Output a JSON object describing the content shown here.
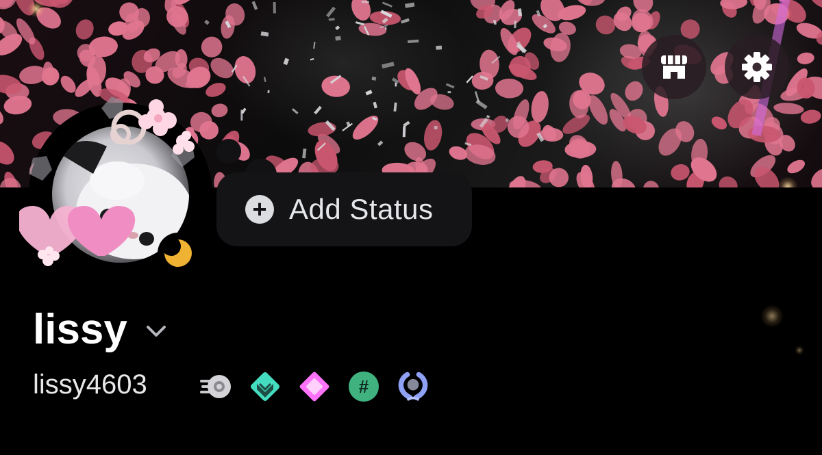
{
  "profile": {
    "display_name": "lissy",
    "username": "lissy4603",
    "status_button_label": "Add Status",
    "online_status": "idle"
  },
  "header_buttons": [
    {
      "name": "nitro-shop-icon"
    },
    {
      "name": "settings-gear-icon"
    }
  ],
  "badges": [
    {
      "name": "hypesquad-speed-badge-icon"
    },
    {
      "name": "hypesquad-bravery-badge-icon"
    },
    {
      "name": "nitro-gem-badge-icon"
    },
    {
      "name": "hashtag-badge-icon"
    },
    {
      "name": "laurel-quest-badge-icon"
    }
  ],
  "colors": {
    "background": "#000000",
    "banner_petal": "#e0758f",
    "idle_moon": "#f0b232",
    "status_bubble": "#141416",
    "hashtag_badge": "#3fb27f",
    "bravery_badge": "#45ddc0",
    "gem_badge": "#ff73fa"
  }
}
